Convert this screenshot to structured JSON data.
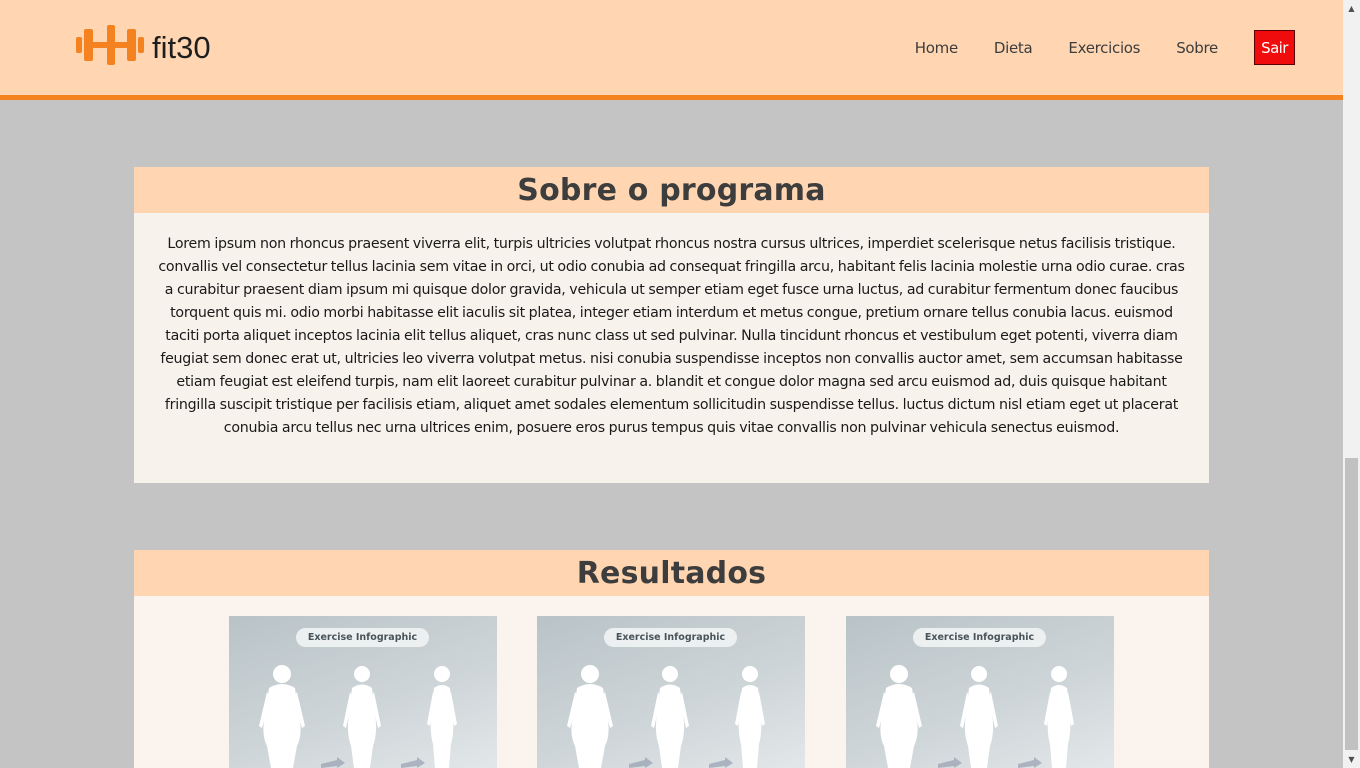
{
  "header": {
    "logo_text": "fit30",
    "logo_icon": "dumbbell-icon",
    "nav": {
      "home": "Home",
      "dieta": "Dieta",
      "exercicios": "Exercicios",
      "sobre": "Sobre"
    },
    "logout": "Sair"
  },
  "about": {
    "title": "Sobre o programa",
    "text": "Lorem ipsum non rhoncus praesent viverra elit, turpis ultricies volutpat rhoncus nostra cursus ultrices, imperdiet scelerisque netus facilisis tristique. convallis vel consectetur tellus lacinia sem vitae in orci, ut odio conubia ad consequat fringilla arcu, habitant felis lacinia molestie urna odio curae. cras a curabitur praesent diam ipsum mi quisque dolor gravida, vehicula ut semper etiam eget fusce urna luctus, ad curabitur fermentum donec faucibus torquent quis mi. odio morbi habitasse elit iaculis sit platea, integer etiam interdum et metus congue, pretium ornare tellus conubia lacus. euismod taciti porta aliquet inceptos lacinia elit tellus aliquet, cras nunc class ut sed pulvinar. Nulla tincidunt rhoncus et vestibulum eget potenti, viverra diam feugiat sem donec erat ut, ultricies leo viverra volutpat metus. nisi conubia suspendisse inceptos non convallis auctor amet, sem accumsan habitasse etiam feugiat est eleifend turpis, nam elit laoreet curabitur pulvinar a. blandit et congue dolor magna sed arcu euismod ad, duis quisque habitant fringilla suscipit tristique per facilisis etiam, aliquet amet sodales elementum sollicitudin suspendisse tellus. luctus dictum nisl etiam eget ut placerat conubia arcu tellus nec urna ultrices enim, posuere eros purus tempus quis vitae convallis non pulvinar vehicula senectus euismod."
  },
  "results": {
    "title": "Resultados",
    "cards": [
      {
        "label": "Exercise Infographic"
      },
      {
        "label": "Exercise Infographic"
      },
      {
        "label": "Exercise Infographic"
      }
    ]
  },
  "colors": {
    "header_bg": "#ffd6b1",
    "accent": "#f58220",
    "logout_bg": "#f00c0c",
    "page_bg": "#c4c4c4",
    "panel_bg": "#f8f2ec"
  }
}
